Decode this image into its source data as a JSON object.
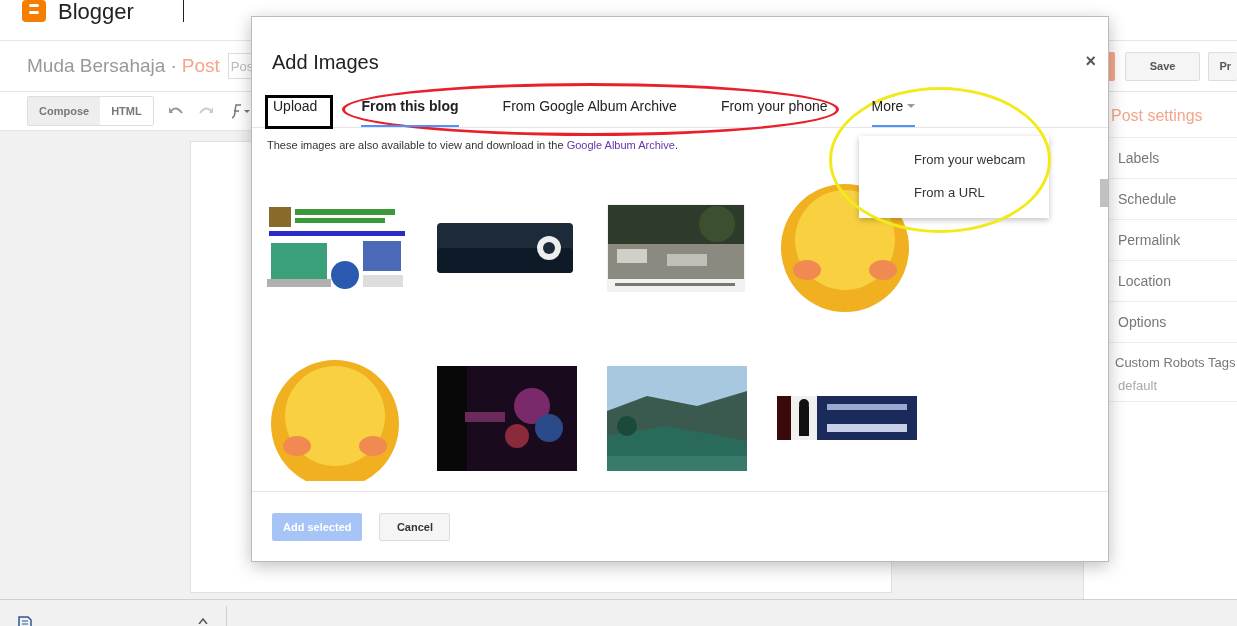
{
  "app": {
    "name": "Blogger"
  },
  "post_bar": {
    "blog_name": "Muda Bersahaja",
    "separator": "·",
    "post_label": "Post",
    "title_placeholder": "Pos",
    "buttons": [
      {
        "label": "Save"
      },
      {
        "label": "Pr"
      }
    ]
  },
  "editor_toolbar": {
    "modes": [
      {
        "label": "Compose",
        "selected": true
      },
      {
        "label": "HTML",
        "selected": false
      }
    ]
  },
  "post_settings": {
    "title": "Post settings",
    "items": [
      "Labels",
      "Schedule",
      "Permalink",
      "Location",
      "Options",
      "Custom Robots Tags"
    ],
    "robots_value": "default"
  },
  "dialog": {
    "title": "Add Images",
    "close": "×",
    "tabs": [
      {
        "label": "Upload",
        "selected": false
      },
      {
        "label": "From this blog",
        "selected": true
      },
      {
        "label": "From Google Album Archive",
        "selected": false
      },
      {
        "label": "From your phone",
        "selected": false
      }
    ],
    "more_tab": {
      "label": "More",
      "expanded": true
    },
    "more_menu": [
      "From your webcam",
      "From a URL"
    ],
    "note": {
      "text": "These images are also available to view and download in the ",
      "link": "Google Album Archive",
      "end": "."
    },
    "buttons": [
      {
        "label": "Add selected",
        "disabled": true
      },
      {
        "label": "Cancel",
        "disabled": false
      }
    ]
  }
}
